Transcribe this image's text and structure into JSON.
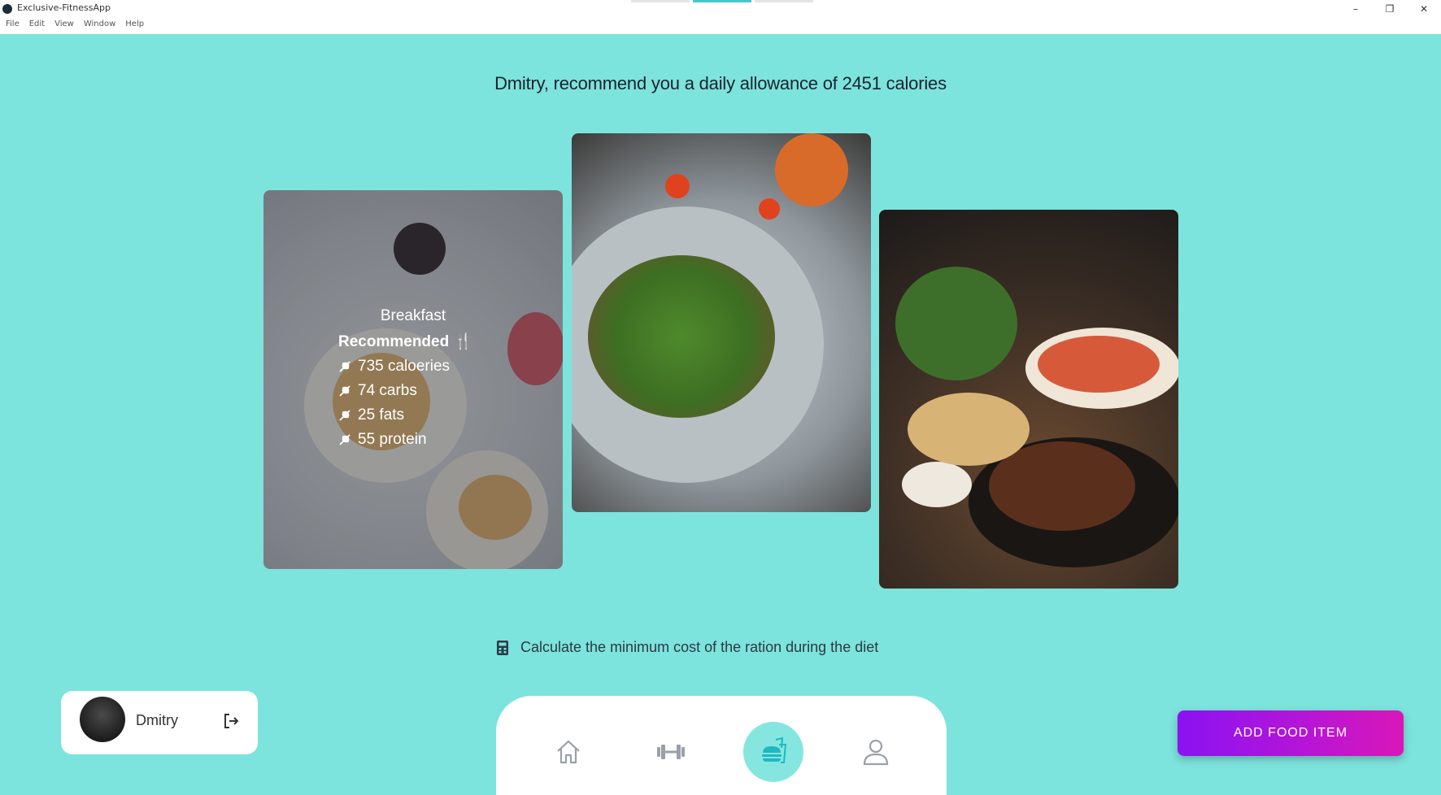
{
  "window": {
    "title": "Exclusive-FitnessApp",
    "menu": [
      "File",
      "Edit",
      "View",
      "Window",
      "Help"
    ],
    "controls": {
      "minimize": "–",
      "restore": "❐",
      "close": "✕"
    }
  },
  "header": {
    "headline": "Dmitry, recommend you a daily allowance of 2451 calories"
  },
  "cards": [
    {
      "meal": "Breakfast",
      "tag": "Recommended 🍴",
      "lines": [
        "735 caloeries",
        "74 carbs",
        "25 fats",
        "55 protein"
      ]
    }
  ],
  "cost": {
    "label": "Calculate the minimum cost of the ration during the diet",
    "icon": "calculator-icon"
  },
  "user": {
    "name": "Dmitry",
    "logout_icon": "logout-icon"
  },
  "nav": {
    "items": [
      "home-icon",
      "dumbbell-icon",
      "food-icon",
      "profile-icon"
    ],
    "active": "food-icon"
  },
  "actions": {
    "add_food": "ADD FOOD ITEM"
  },
  "colors": {
    "background": "#7de3dd",
    "accent": "#46c7cf",
    "button_start": "#8a12f2",
    "button_end": "#d917b8"
  }
}
